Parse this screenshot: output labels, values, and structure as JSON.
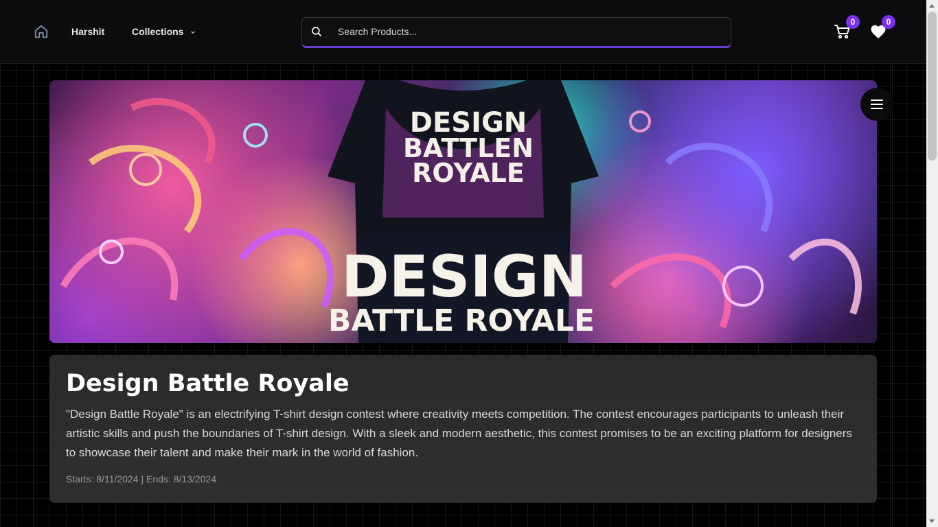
{
  "header": {
    "nav": {
      "home_icon": "home-icon",
      "harshit_label": "Harshit",
      "collections_label": "Collections"
    },
    "search": {
      "placeholder": "Search Products...",
      "icon": "search-icon"
    },
    "cart": {
      "icon": "cart-icon",
      "count": "0"
    },
    "wishlist": {
      "icon": "heart-icon",
      "count": "0"
    },
    "accent_color": "#7b2ff2"
  },
  "banner": {
    "image_text_top": [
      "DESIGN",
      "BATTLEN",
      "ROYALE"
    ],
    "image_text_bottom": [
      "DESIGN",
      "BATTLE ROYALE"
    ],
    "menu_icon": "hamburger-menu-icon"
  },
  "contest": {
    "title": "Design Battle Royale",
    "description": "\"Design Battle Royale\" is an electrifying T-shirt design contest where creativity meets competition. The contest encourages participants to unleash their artistic skills and push the boundaries of T-shirt design. With a sleek and modern aesthetic, this contest promises to be an exciting platform for designers to showcase their talent and make their mark in the world of fashion.",
    "starts_label": "Starts: 8/11/2024",
    "separator": " | ",
    "ends_label": "Ends: 8/13/2024"
  }
}
